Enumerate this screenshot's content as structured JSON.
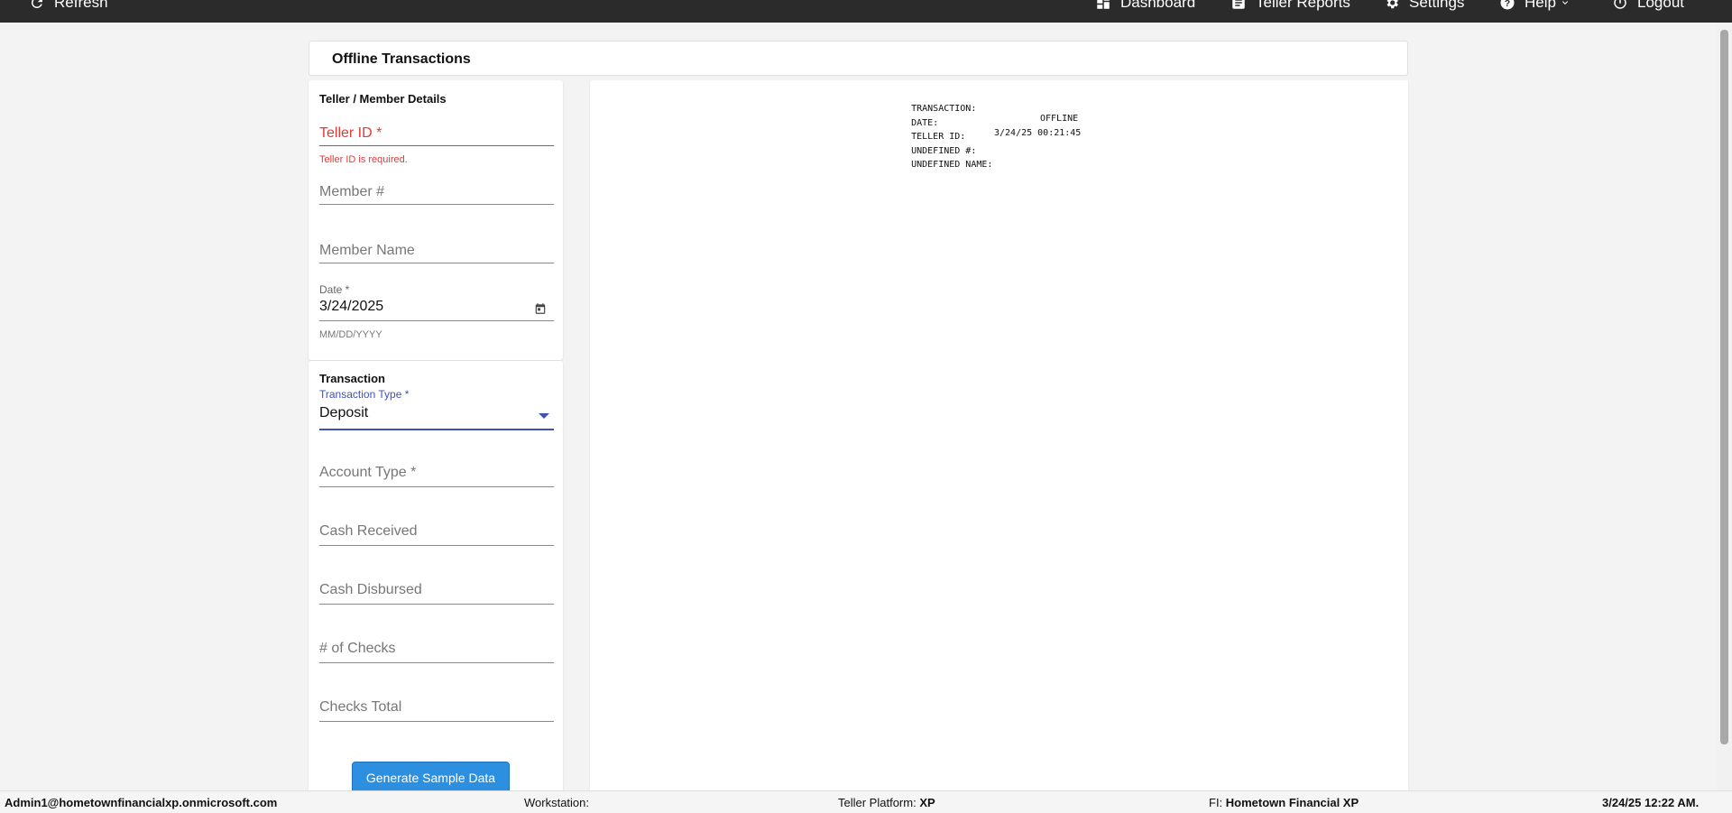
{
  "nav": {
    "refresh": "Refresh",
    "dashboard": "Dashboard",
    "teller_reports": "Teller Reports",
    "settings": "Settings",
    "help": "Help",
    "logout": "Logout"
  },
  "header": {
    "title": "Offline Transactions"
  },
  "teller_member": {
    "section_title": "Teller / Member Details",
    "teller_id_placeholder": "Teller ID *",
    "teller_id_error": "Teller ID is required.",
    "member_number_placeholder": "Member #",
    "member_name_placeholder": "Member Name",
    "date_label": "Date *",
    "date_value": "3/24/2025",
    "date_hint": "MM/DD/YYYY"
  },
  "transaction": {
    "section_title": "Transaction",
    "type_label": "Transaction Type *",
    "type_value": "Deposit",
    "account_type_placeholder": "Account Type *",
    "cash_received_placeholder": "Cash Received",
    "cash_disbursed_placeholder": "Cash Disbursed",
    "num_checks_placeholder": "# of Checks",
    "checks_total_placeholder": "Checks Total",
    "generate_button": "Generate Sample Data"
  },
  "receipt": {
    "rows": [
      {
        "label": "TRANSACTION:",
        "value": "OFFLINE"
      },
      {
        "label": "DATE:",
        "value": "3/24/25 00:21:45"
      },
      {
        "label": "TELLER ID:",
        "value": ""
      },
      {
        "label": "UNDEFINED #:",
        "value": ""
      },
      {
        "label": "UNDEFINED NAME:",
        "value": ""
      }
    ]
  },
  "status": {
    "user": "Admin1@hometownfinancialxp.onmicrosoft.com",
    "workstation_label": "Workstation:",
    "workstation_value": "",
    "platform_label": "Teller Platform:",
    "platform_value": "XP",
    "fi_label": "FI:",
    "fi_value": "Hometown Financial XP",
    "datetime": "3/24/25 12:22 AM."
  },
  "colors": {
    "topbar": "#2b2b2b",
    "error": "#e53935",
    "accent": "#3f51b5",
    "button": "#2d8fe0"
  }
}
